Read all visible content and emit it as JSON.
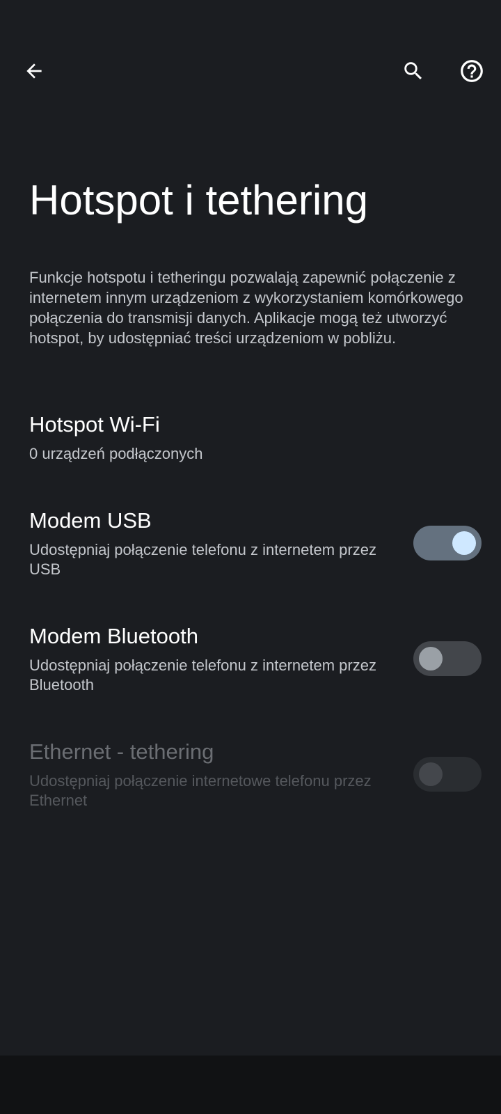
{
  "toolbar": {
    "back_icon": "arrow-back-icon",
    "search_icon": "search-icon",
    "help_icon": "help-circle-icon"
  },
  "page": {
    "title": "Hotspot i tethering",
    "intro": "Funkcje hotspotu i tetheringu pozwalają zapewnić połączenie z internetem innym urządzeniom z wykorzystaniem komórkowego połączenia do transmisji danych. Aplikacje mogą też utworzyć hotspot, by udostępniać treści urządzeniom w pobliżu."
  },
  "prefs": {
    "hotspot": {
      "title": "Hotspot Wi-Fi",
      "summary": "0 urządzeń podłączonych"
    },
    "usb": {
      "title": "Modem USB",
      "summary": "Udostępniaj połączenie telefonu z internetem przez USB",
      "checked": true
    },
    "bluetooth": {
      "title": "Modem Bluetooth",
      "summary": "Udostępniaj połączenie telefonu z internetem przez Bluetooth",
      "checked": false
    },
    "ethernet": {
      "title": "Ethernet - tethering",
      "summary": "Udostępniaj połączenie internetowe telefonu przez Ethernet",
      "checked": false,
      "enabled": false
    }
  },
  "colors": {
    "background": "#1b1d21",
    "switch_on_track": "#64717f",
    "switch_on_thumb": "#cfe8ff"
  }
}
